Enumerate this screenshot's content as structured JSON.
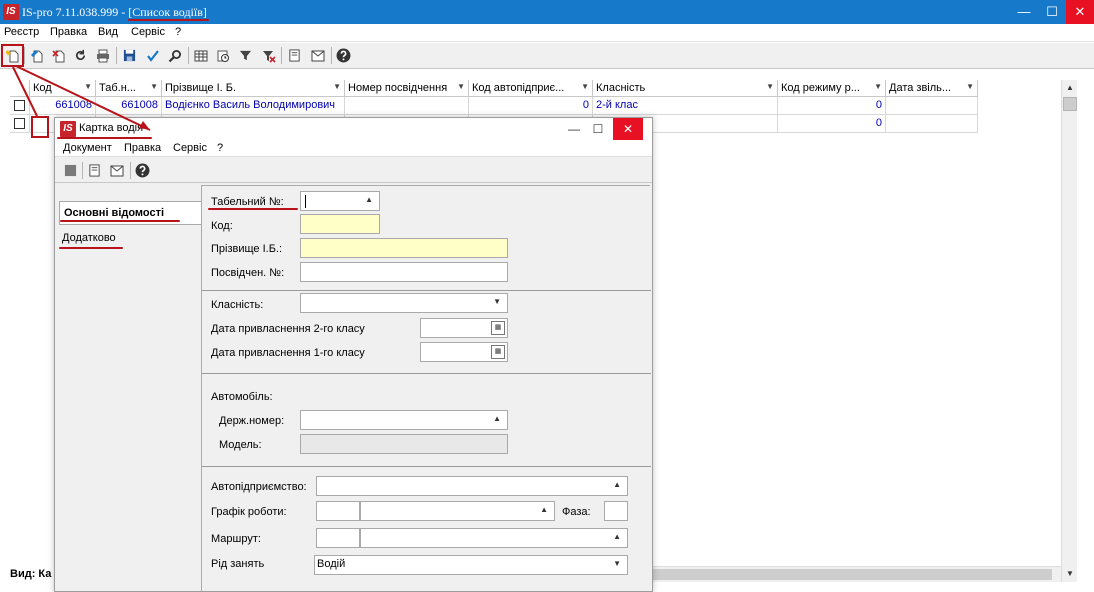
{
  "main": {
    "title": "IS-pro 7.11.038.999 - [Список водіїв]",
    "logo": "IS",
    "menu": [
      "Реєстр",
      "Правка",
      "Вид",
      "Сервіс",
      "?"
    ],
    "window_controls": {
      "minimize": "—",
      "maximize": "☐",
      "close": "✕"
    }
  },
  "grid": {
    "columns": [
      "Код",
      "Таб.н...",
      "Прізвище І. Б.",
      "Номер посвідчення",
      "Код автопідприє...",
      "Класність",
      "Код режиму р...",
      "Дата звіль..."
    ],
    "rows": [
      {
        "code": "661008",
        "tab": "661008",
        "name": "Водієнко Василь Володимирович",
        "license": "",
        "auto_code": "0",
        "class": "2-й клас",
        "mode_code": "0",
        "dismissal": ""
      },
      {
        "code": "",
        "tab": "",
        "name": "",
        "license": "",
        "auto_code": "",
        "class": "",
        "mode_code": "0",
        "dismissal": ""
      }
    ]
  },
  "status": {
    "text": "Вид: Ка"
  },
  "dialog": {
    "title": "Картка водія",
    "logo": "IS",
    "menu": [
      "Документ",
      "Правка",
      "Сервіс",
      "?"
    ],
    "tabs": {
      "main": "Основні відомості",
      "extra": "Додатково"
    },
    "fields": {
      "tab_no_label": "Табельний №:",
      "code_label": "Код:",
      "surname_label": "Прізвище І.Б.:",
      "license_label": "Посвідчен. №:",
      "class_label": "Класність:",
      "date2_label": "Дата привласнення 2-го класу",
      "date1_label": "Дата привласнення 1-го класу",
      "car_label": "Автомобіль:",
      "plate_label": "Держ.номер:",
      "model_label": "Модель:",
      "enterprise_label": "Автопідприємство:",
      "schedule_label": "Графік роботи:",
      "shift_label": "Фаза:",
      "route_label": "Маршрут:",
      "activity_label": "Рід занять",
      "activity_value": "Водій"
    }
  },
  "colors": {
    "titlebar": "#1679c9",
    "close": "#e81123",
    "annotation": "#b8131a",
    "required": "#ffffc8",
    "link_text": "#0000b0"
  }
}
